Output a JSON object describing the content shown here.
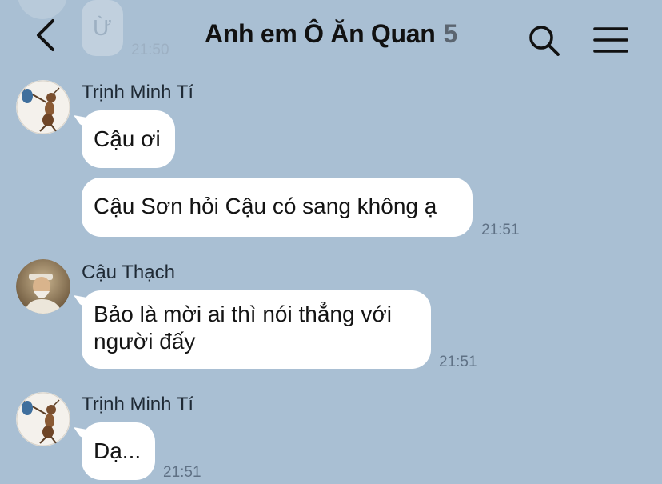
{
  "previous_message": {
    "text": "Ừ",
    "time": "21:50"
  },
  "header": {
    "title": "Anh em Ô Ăn Quan",
    "member_count": "5",
    "back_icon": "chevron-left-icon",
    "search_icon": "search-icon",
    "menu_icon": "hamburger-menu-icon"
  },
  "messages": [
    {
      "sender": "Trịnh Minh Tí",
      "avatar_icon": "ant-character-avatar",
      "bubbles": [
        "Cậu ơi",
        "Cậu Sơn hỏi Cậu có sang không ạ"
      ],
      "time": "21:51"
    },
    {
      "sender": "Cậu Thạch",
      "avatar_icon": "old-man-avatar",
      "bubbles": [
        "Bảo là mời ai thì nói thẳng với người đấy"
      ],
      "time": "21:51"
    },
    {
      "sender": "Trịnh Minh Tí",
      "avatar_icon": "ant-character-avatar",
      "bubbles": [
        "Dạ..."
      ],
      "time": "21:51"
    }
  ],
  "colors": {
    "background": "#a9bfd3",
    "bubble": "#ffffff",
    "time_text": "#5f7185",
    "member_count": "#5b6570"
  }
}
